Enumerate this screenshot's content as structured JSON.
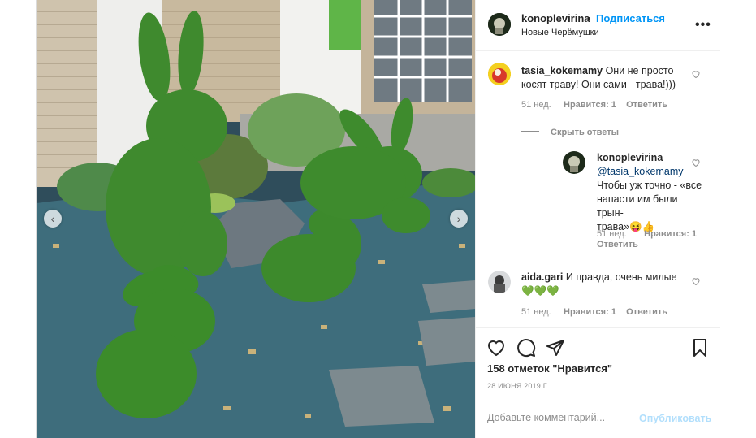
{
  "header": {
    "username": "konoplevirina",
    "separator": "•",
    "follow_label": "Подписаться",
    "location": "Новые Черёмушки",
    "more_label": "•••"
  },
  "comments": [
    {
      "username": "tasia_kokemamy",
      "text": "Они не просто косят траву! Они сами - трава!)))",
      "time": "51 нед.",
      "likes": "Нравится: 1",
      "reply": "Ответить"
    },
    {
      "username": "aida.gari",
      "text": "И правда, очень милые",
      "hearts": "💚💚💚",
      "time": "51 нед.",
      "likes": "Нравится: 1",
      "reply": "Ответить"
    }
  ],
  "hide_replies_label": "Скрыть ответы",
  "reply_comment": {
    "username": "konoplevirina",
    "mention": "@tasia_kokemamy",
    "text_line1": "Чтобы уж точно - «все",
    "text_line2": "напасти им были трын-",
    "text_line3": "трава»",
    "emoji": "😝👍",
    "time": "51 нед.",
    "likes": "Нравится: 1",
    "reply": "Ответить"
  },
  "actions": {
    "likes_count": "158 отметок \"Нравится\"",
    "date": "28 ИЮНЯ 2019 Г."
  },
  "add_comment": {
    "placeholder": "Добавьте комментарий...",
    "post_label": "Опубликовать"
  },
  "colors": {
    "accent": "#0095f6",
    "post_disabled": "#b2dffc",
    "muted": "#8e8e8e"
  }
}
